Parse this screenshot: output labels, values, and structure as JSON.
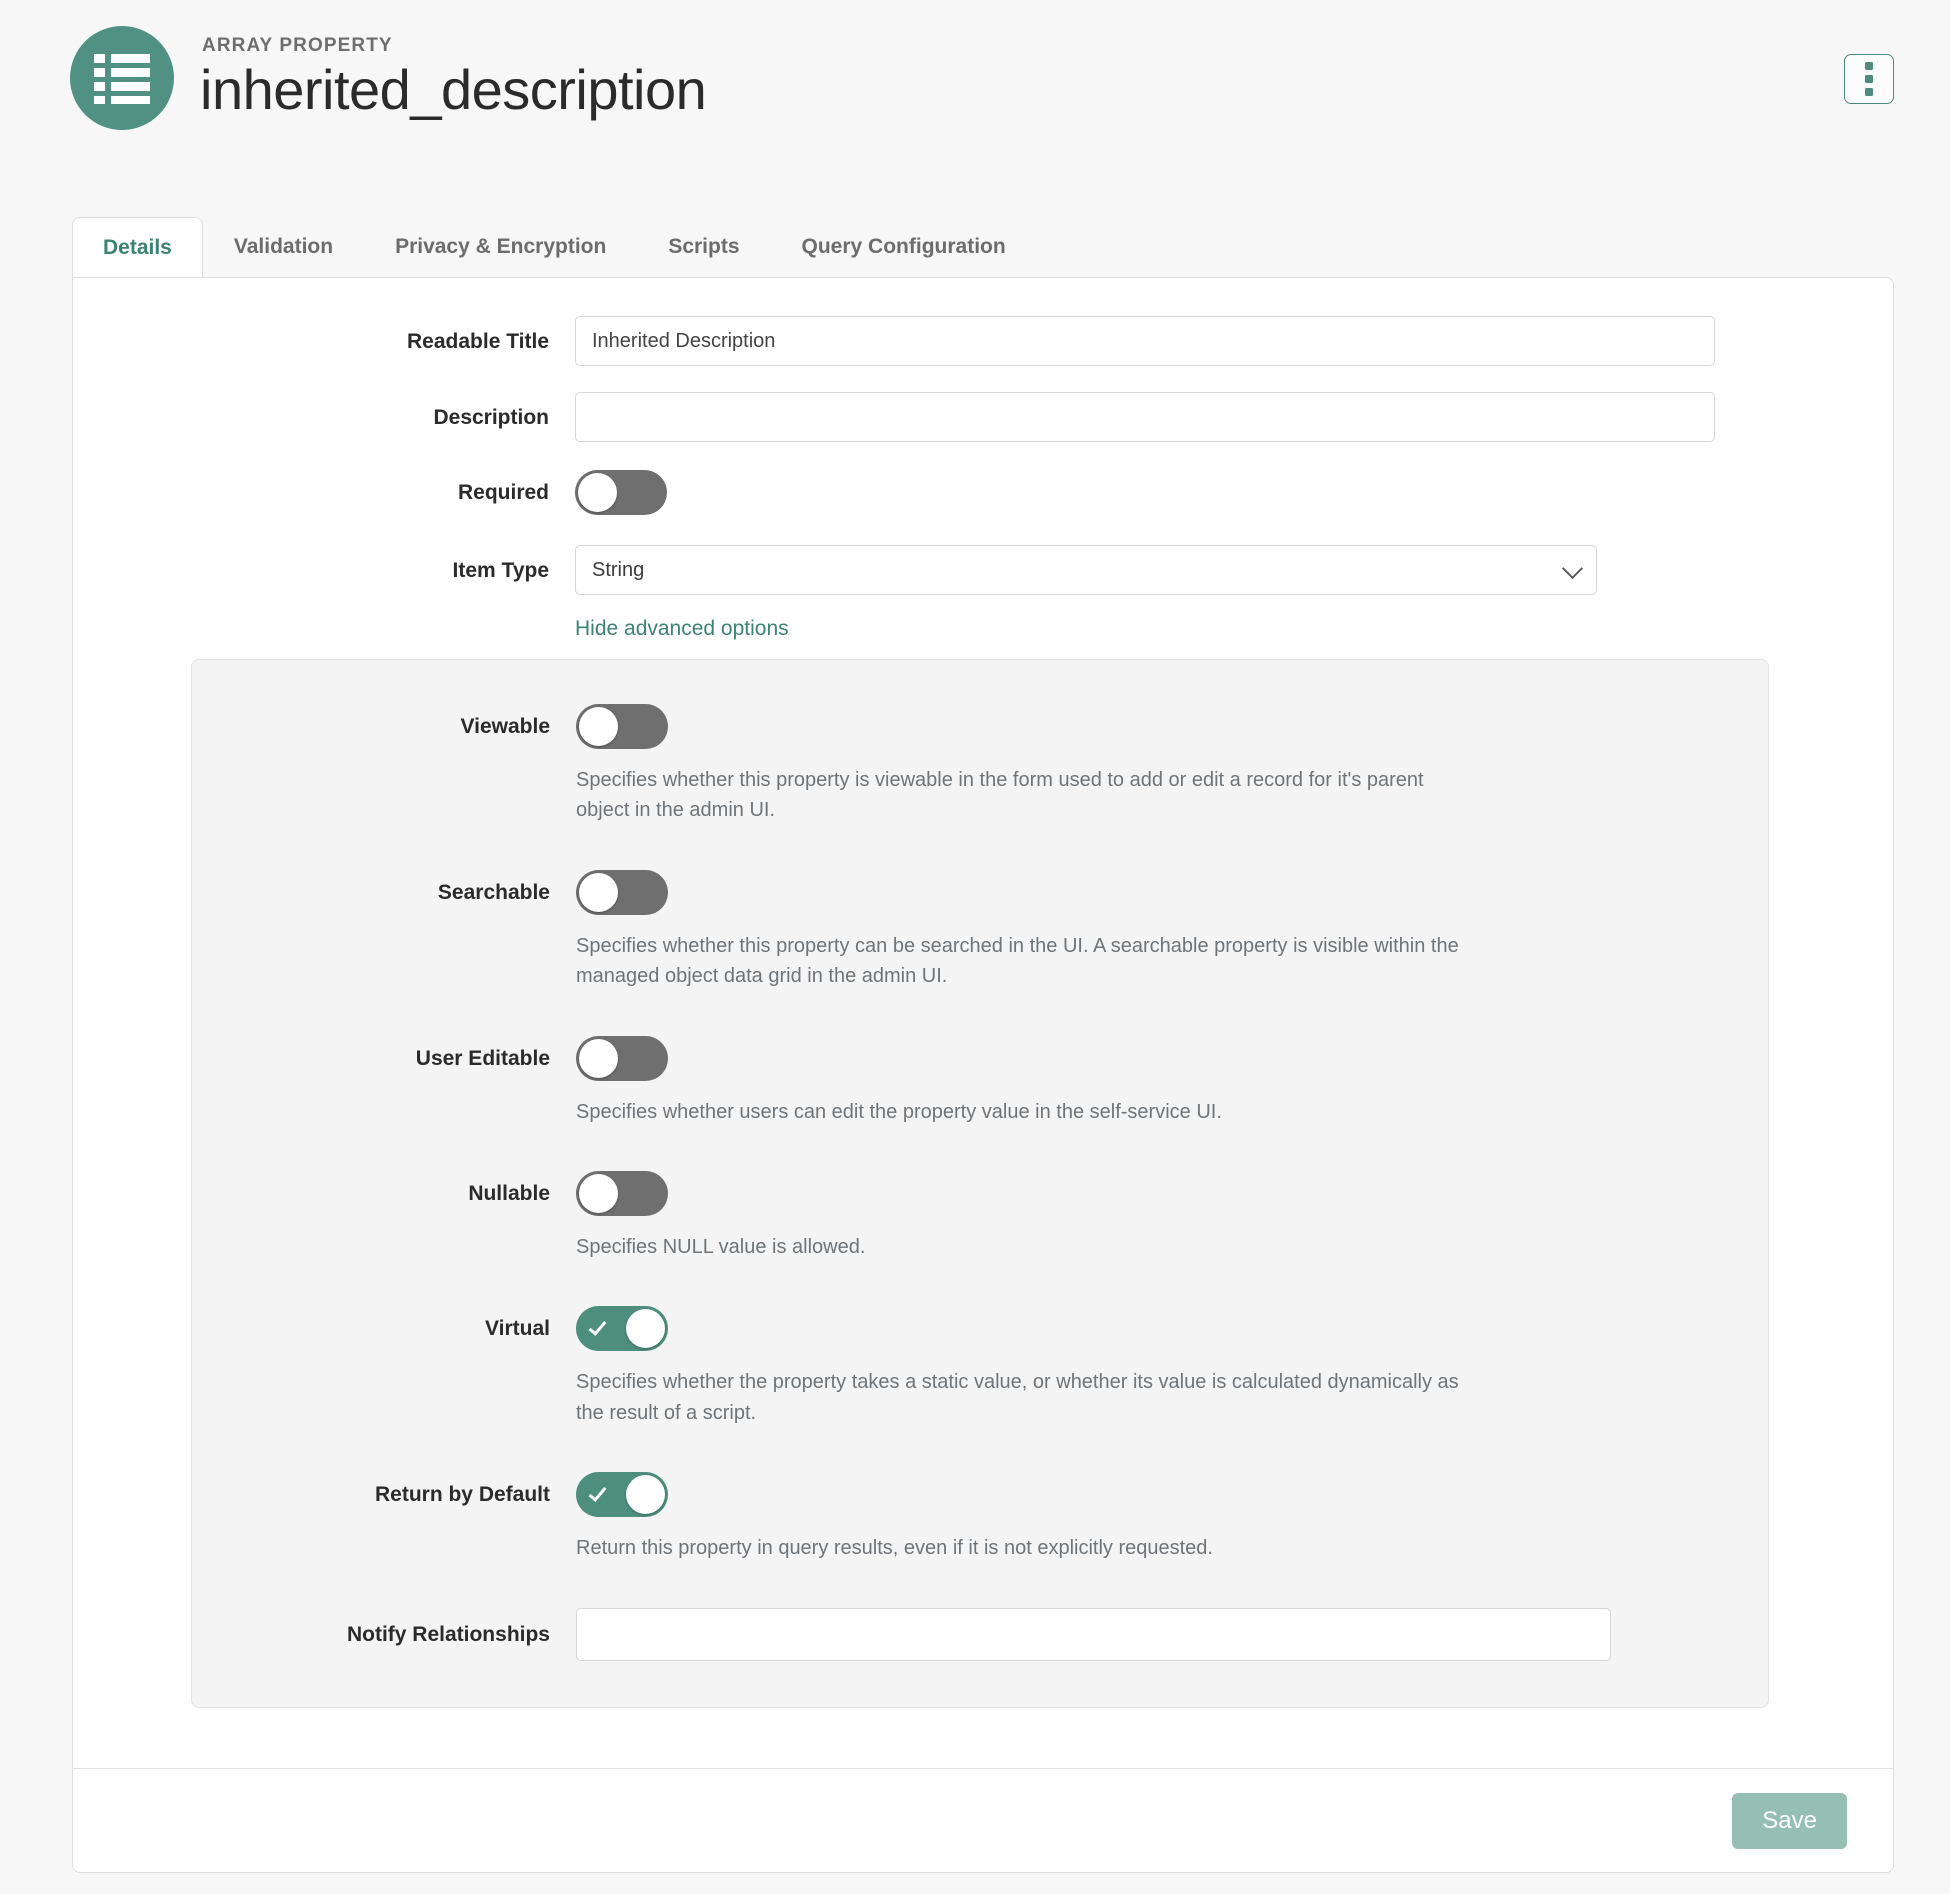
{
  "header": {
    "eyebrow": "ARRAY PROPERTY",
    "title": "inherited_description",
    "icon": "list-icon",
    "accent_color": "#519183",
    "menu_icon": "kebab-menu-icon"
  },
  "tabs": [
    {
      "label": "Details",
      "active": true
    },
    {
      "label": "Validation",
      "active": false
    },
    {
      "label": "Privacy & Encryption",
      "active": false
    },
    {
      "label": "Scripts",
      "active": false
    },
    {
      "label": "Query Configuration",
      "active": false
    }
  ],
  "form": {
    "readable_title": {
      "label": "Readable Title",
      "value": "Inherited Description",
      "placeholder": ""
    },
    "description": {
      "label": "Description",
      "value": "",
      "placeholder": ""
    },
    "required": {
      "label": "Required",
      "state": "off"
    },
    "item_type": {
      "label": "Item Type",
      "value": "String",
      "chevron_icon": "chevron-down-icon"
    },
    "advanced_toggle_link": "Hide advanced options"
  },
  "advanced": {
    "viewable": {
      "label": "Viewable",
      "state": "off",
      "help": "Specifies whether this property is viewable in the form used to add or edit a record for it's parent object in the admin UI."
    },
    "searchable": {
      "label": "Searchable",
      "state": "off",
      "help": "Specifies whether this property can be searched in the UI. A searchable property is visible within the managed object data grid in the admin UI."
    },
    "user_editable": {
      "label": "User Editable",
      "state": "off",
      "help": "Specifies whether users can edit the property value in the self-service UI."
    },
    "nullable": {
      "label": "Nullable",
      "state": "off",
      "help": "Specifies NULL value is allowed."
    },
    "virtual": {
      "label": "Virtual",
      "state": "on",
      "help": "Specifies whether the property takes a static value, or whether its value is calculated dynamically as the result of a script."
    },
    "return_by_default": {
      "label": "Return by Default",
      "state": "on",
      "help": "Return this property in query results, even if it is not explicitly requested."
    },
    "notify_relationships": {
      "label": "Notify Relationships",
      "value": "",
      "placeholder": ""
    }
  },
  "footer": {
    "save_label": "Save",
    "save_color": "#96bfb3"
  }
}
